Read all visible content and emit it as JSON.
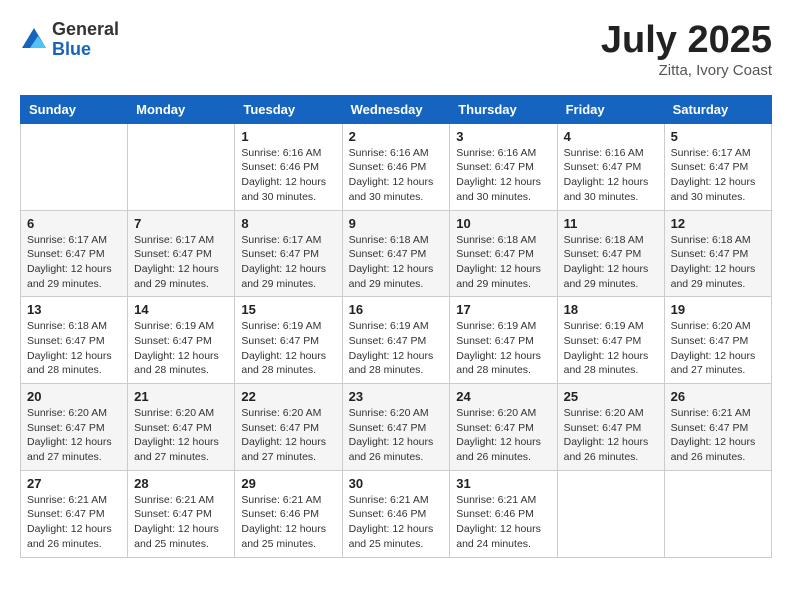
{
  "header": {
    "logo_general": "General",
    "logo_blue": "Blue",
    "month": "July 2025",
    "location": "Zitta, Ivory Coast"
  },
  "weekdays": [
    "Sunday",
    "Monday",
    "Tuesday",
    "Wednesday",
    "Thursday",
    "Friday",
    "Saturday"
  ],
  "weeks": [
    [
      {
        "day": "",
        "info": ""
      },
      {
        "day": "",
        "info": ""
      },
      {
        "day": "1",
        "info": "Sunrise: 6:16 AM\nSunset: 6:46 PM\nDaylight: 12 hours and 30 minutes."
      },
      {
        "day": "2",
        "info": "Sunrise: 6:16 AM\nSunset: 6:46 PM\nDaylight: 12 hours and 30 minutes."
      },
      {
        "day": "3",
        "info": "Sunrise: 6:16 AM\nSunset: 6:47 PM\nDaylight: 12 hours and 30 minutes."
      },
      {
        "day": "4",
        "info": "Sunrise: 6:16 AM\nSunset: 6:47 PM\nDaylight: 12 hours and 30 minutes."
      },
      {
        "day": "5",
        "info": "Sunrise: 6:17 AM\nSunset: 6:47 PM\nDaylight: 12 hours and 30 minutes."
      }
    ],
    [
      {
        "day": "6",
        "info": "Sunrise: 6:17 AM\nSunset: 6:47 PM\nDaylight: 12 hours and 29 minutes."
      },
      {
        "day": "7",
        "info": "Sunrise: 6:17 AM\nSunset: 6:47 PM\nDaylight: 12 hours and 29 minutes."
      },
      {
        "day": "8",
        "info": "Sunrise: 6:17 AM\nSunset: 6:47 PM\nDaylight: 12 hours and 29 minutes."
      },
      {
        "day": "9",
        "info": "Sunrise: 6:18 AM\nSunset: 6:47 PM\nDaylight: 12 hours and 29 minutes."
      },
      {
        "day": "10",
        "info": "Sunrise: 6:18 AM\nSunset: 6:47 PM\nDaylight: 12 hours and 29 minutes."
      },
      {
        "day": "11",
        "info": "Sunrise: 6:18 AM\nSunset: 6:47 PM\nDaylight: 12 hours and 29 minutes."
      },
      {
        "day": "12",
        "info": "Sunrise: 6:18 AM\nSunset: 6:47 PM\nDaylight: 12 hours and 29 minutes."
      }
    ],
    [
      {
        "day": "13",
        "info": "Sunrise: 6:18 AM\nSunset: 6:47 PM\nDaylight: 12 hours and 28 minutes."
      },
      {
        "day": "14",
        "info": "Sunrise: 6:19 AM\nSunset: 6:47 PM\nDaylight: 12 hours and 28 minutes."
      },
      {
        "day": "15",
        "info": "Sunrise: 6:19 AM\nSunset: 6:47 PM\nDaylight: 12 hours and 28 minutes."
      },
      {
        "day": "16",
        "info": "Sunrise: 6:19 AM\nSunset: 6:47 PM\nDaylight: 12 hours and 28 minutes."
      },
      {
        "day": "17",
        "info": "Sunrise: 6:19 AM\nSunset: 6:47 PM\nDaylight: 12 hours and 28 minutes."
      },
      {
        "day": "18",
        "info": "Sunrise: 6:19 AM\nSunset: 6:47 PM\nDaylight: 12 hours and 28 minutes."
      },
      {
        "day": "19",
        "info": "Sunrise: 6:20 AM\nSunset: 6:47 PM\nDaylight: 12 hours and 27 minutes."
      }
    ],
    [
      {
        "day": "20",
        "info": "Sunrise: 6:20 AM\nSunset: 6:47 PM\nDaylight: 12 hours and 27 minutes."
      },
      {
        "day": "21",
        "info": "Sunrise: 6:20 AM\nSunset: 6:47 PM\nDaylight: 12 hours and 27 minutes."
      },
      {
        "day": "22",
        "info": "Sunrise: 6:20 AM\nSunset: 6:47 PM\nDaylight: 12 hours and 27 minutes."
      },
      {
        "day": "23",
        "info": "Sunrise: 6:20 AM\nSunset: 6:47 PM\nDaylight: 12 hours and 26 minutes."
      },
      {
        "day": "24",
        "info": "Sunrise: 6:20 AM\nSunset: 6:47 PM\nDaylight: 12 hours and 26 minutes."
      },
      {
        "day": "25",
        "info": "Sunrise: 6:20 AM\nSunset: 6:47 PM\nDaylight: 12 hours and 26 minutes."
      },
      {
        "day": "26",
        "info": "Sunrise: 6:21 AM\nSunset: 6:47 PM\nDaylight: 12 hours and 26 minutes."
      }
    ],
    [
      {
        "day": "27",
        "info": "Sunrise: 6:21 AM\nSunset: 6:47 PM\nDaylight: 12 hours and 26 minutes."
      },
      {
        "day": "28",
        "info": "Sunrise: 6:21 AM\nSunset: 6:47 PM\nDaylight: 12 hours and 25 minutes."
      },
      {
        "day": "29",
        "info": "Sunrise: 6:21 AM\nSunset: 6:46 PM\nDaylight: 12 hours and 25 minutes."
      },
      {
        "day": "30",
        "info": "Sunrise: 6:21 AM\nSunset: 6:46 PM\nDaylight: 12 hours and 25 minutes."
      },
      {
        "day": "31",
        "info": "Sunrise: 6:21 AM\nSunset: 6:46 PM\nDaylight: 12 hours and 24 minutes."
      },
      {
        "day": "",
        "info": ""
      },
      {
        "day": "",
        "info": ""
      }
    ]
  ]
}
